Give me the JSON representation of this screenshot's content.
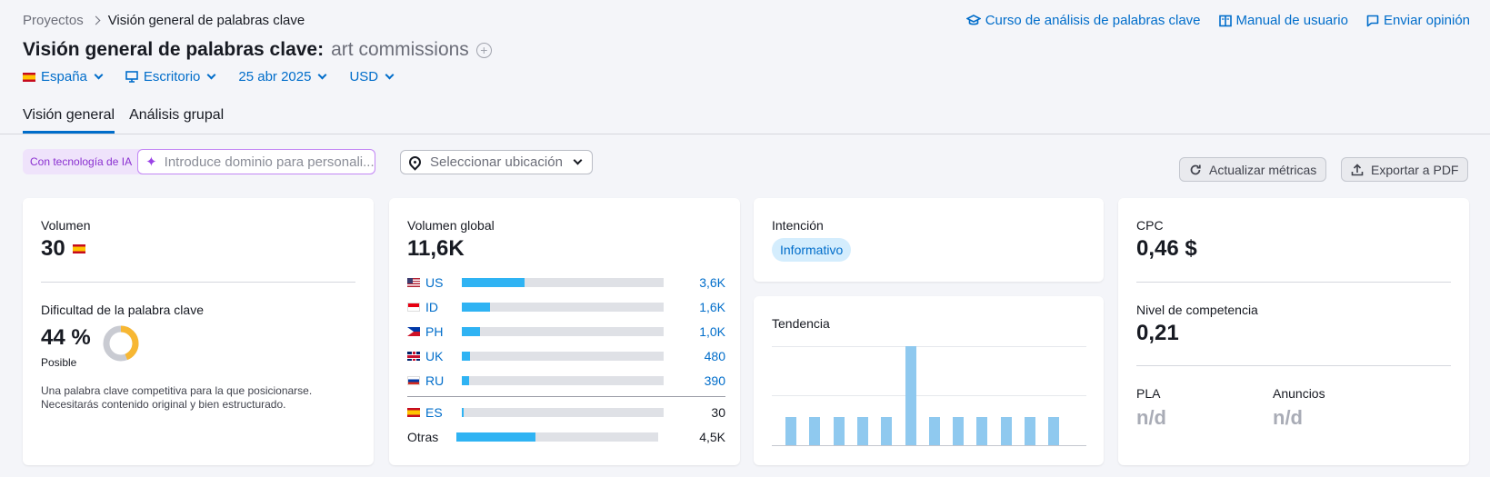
{
  "breadcrumb": {
    "root": "Proyectos",
    "current": "Visión general de palabras clave"
  },
  "toplinks": {
    "course": "Curso de análisis de palabras clave",
    "manual": "Manual de usuario",
    "feedback": "Enviar opinión"
  },
  "header": {
    "title": "Visión general de palabras clave:",
    "keyword": "art commissions"
  },
  "filters": {
    "country": "España",
    "device": "Escritorio",
    "date": "25 abr 2025",
    "currency": "USD"
  },
  "tabs": [
    "Visión general",
    "Análisis grupal"
  ],
  "toolbar": {
    "ai_label": "Con tecnología de IA",
    "ai_placeholder": "Introduce dominio para personali...",
    "location_placeholder": "Seleccionar ubicación",
    "refresh": "Actualizar métricas",
    "export": "Exportar a PDF"
  },
  "volume": {
    "label": "Volumen",
    "value": "30"
  },
  "difficulty": {
    "label": "Dificultad de la palabra clave",
    "value": "44 %",
    "percent": 44,
    "level": "Posible",
    "description_line1": "Una palabra clave competitiva para la que posicionarse.",
    "description_line2": "Necesitarás contenido original y bien estructurado."
  },
  "global_volume": {
    "label": "Volumen global",
    "value": "11,6K",
    "rows": [
      {
        "code": "US",
        "value": "3,6K",
        "share": 0.31,
        "flag": "us"
      },
      {
        "code": "ID",
        "value": "1,6K",
        "share": 0.14,
        "flag": "id"
      },
      {
        "code": "PH",
        "value": "1,0K",
        "share": 0.09,
        "flag": "ph"
      },
      {
        "code": "UK",
        "value": "480",
        "share": 0.04,
        "flag": "uk"
      },
      {
        "code": "RU",
        "value": "390",
        "share": 0.035,
        "flag": "ru"
      }
    ],
    "es_row": {
      "code": "ES",
      "value": "30",
      "share": 0.01
    },
    "others_row": {
      "code": "Otras",
      "value": "4,5K",
      "share": 0.39
    }
  },
  "intent": {
    "label": "Intención",
    "value": "Informativo"
  },
  "trend": {
    "label": "Tendencia",
    "values": [
      0.28,
      0.28,
      0.28,
      0.28,
      0.28,
      1.0,
      0.28,
      0.28,
      0.28,
      0.28,
      0.28,
      0.28
    ]
  },
  "cpc": {
    "label": "CPC",
    "value": "0,46 $"
  },
  "competition": {
    "label": "Nivel de competencia",
    "value": "0,21"
  },
  "pla": {
    "label": "PLA",
    "value": "n/d"
  },
  "ads": {
    "label": "Anuncios",
    "value": "n/d"
  },
  "colors": {
    "accent": "#006dca",
    "bar": "#2fb3f3",
    "trend_bar": "#8fc9ef",
    "difficulty": "#f7b733"
  }
}
